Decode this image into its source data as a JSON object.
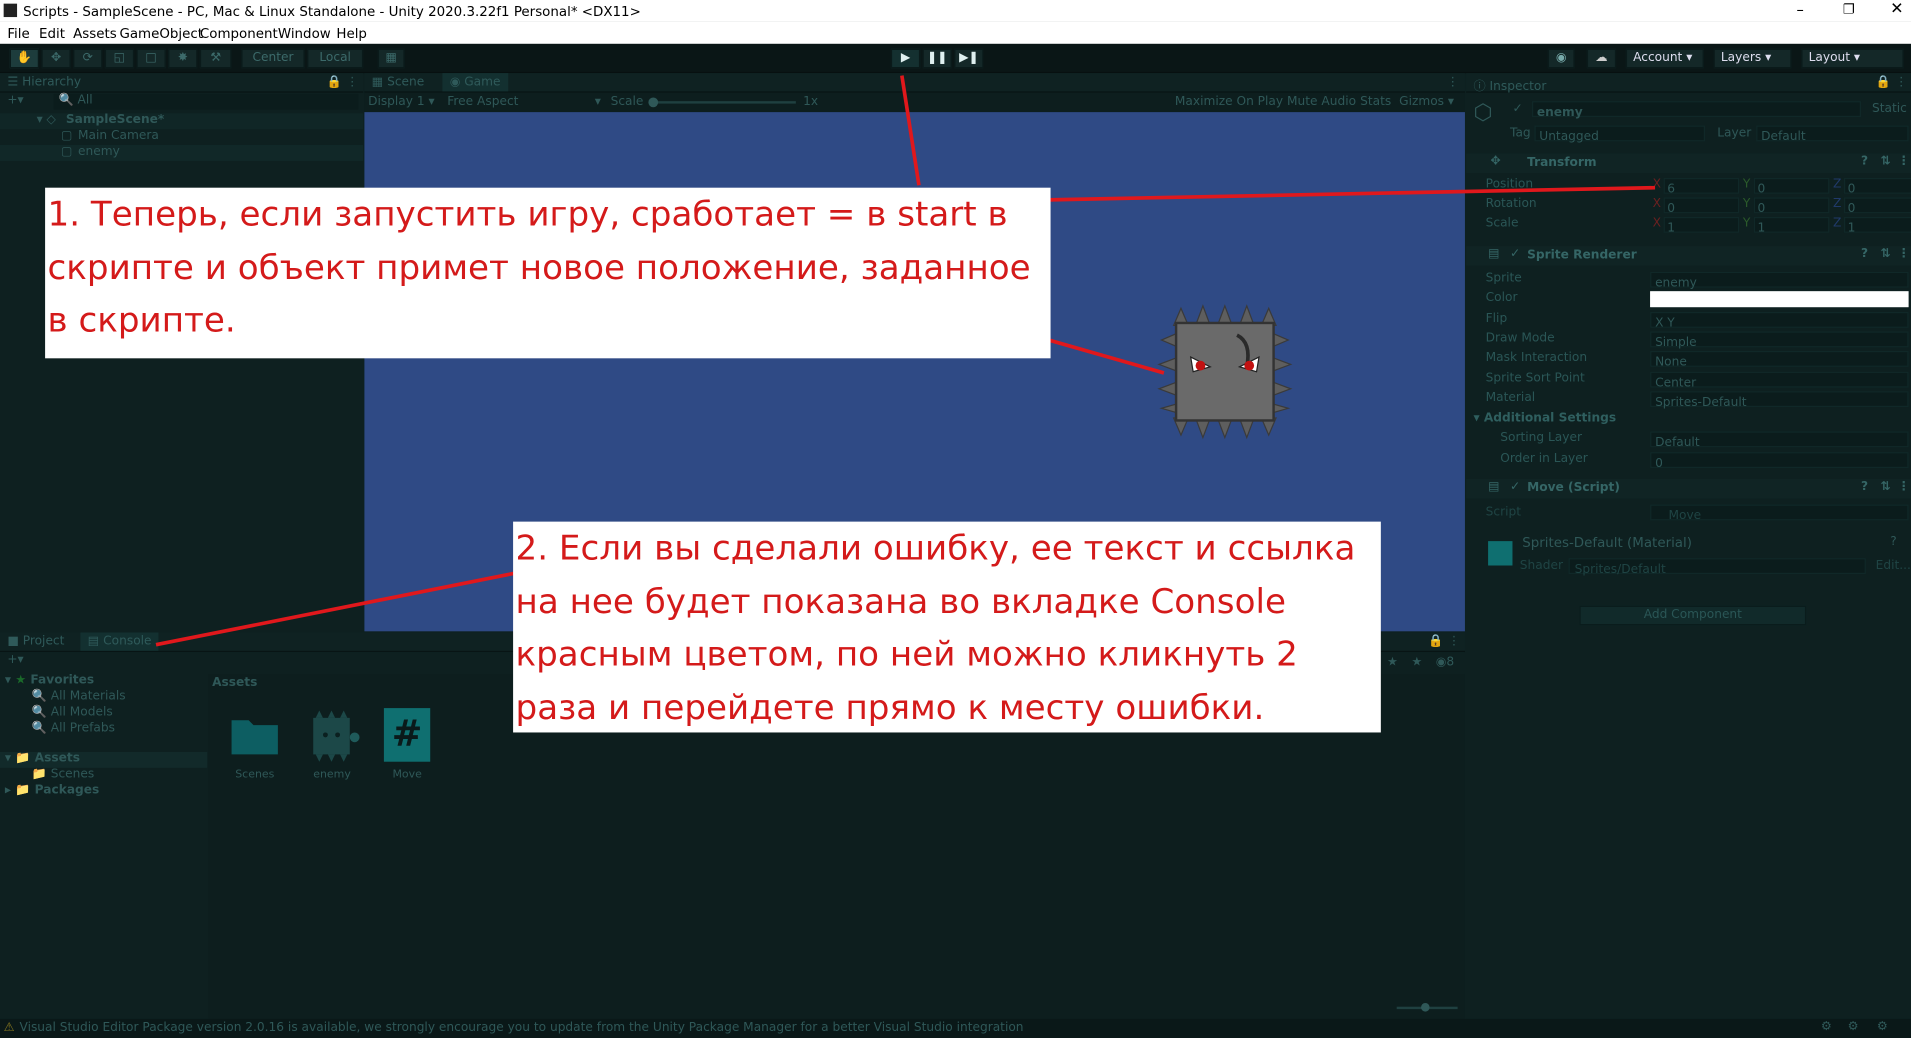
{
  "window": {
    "title": "Scripts - SampleScene - PC, Mac & Linux Standalone - Unity 2020.3.22f1 Personal* <DX11>"
  },
  "menu": [
    "File",
    "Edit",
    "Assets",
    "GameObject",
    "Component",
    "Window",
    "Help"
  ],
  "toolbar": {
    "pivot": "Center",
    "space": "Local",
    "account": "Account",
    "layers": "Layers",
    "layout": "Layout"
  },
  "hierarchy": {
    "tab": "Hierarchy",
    "search": "All",
    "scene": "SampleScene*",
    "items": [
      "Main Camera",
      "enemy"
    ]
  },
  "scene_tabs": {
    "scene": "Scene",
    "game": "Game"
  },
  "game_bar": {
    "display": "Display 1",
    "aspect": "Free Aspect",
    "scale_label": "Scale",
    "scale_value": "1x",
    "maximize": "Maximize On Play",
    "mute": "Mute Audio",
    "stats": "Stats",
    "gizmos": "Gizmos"
  },
  "inspector": {
    "tab": "Inspector",
    "object_name": "enemy",
    "static": "Static",
    "tag_label": "Tag",
    "tag": "Untagged",
    "layer_label": "Layer",
    "layer": "Default",
    "transform": {
      "title": "Transform",
      "rows": [
        {
          "label": "Position",
          "x": "6",
          "y": "0",
          "z": "0"
        },
        {
          "label": "Rotation",
          "x": "0",
          "y": "0",
          "z": "0"
        },
        {
          "label": "Scale",
          "x": "1",
          "y": "1",
          "z": "1"
        }
      ]
    },
    "sprite_renderer": {
      "title": "Sprite Renderer",
      "rows": [
        {
          "label": "Sprite",
          "value": "enemy"
        },
        {
          "label": "Color",
          "value": ""
        },
        {
          "label": "Flip",
          "value": "X   Y"
        },
        {
          "label": "Draw Mode",
          "value": "Simple"
        },
        {
          "label": "Mask Interaction",
          "value": "None"
        },
        {
          "label": "Sprite Sort Point",
          "value": "Center"
        },
        {
          "label": "Material",
          "value": "Sprites-Default"
        }
      ],
      "additional": "Additional Settings",
      "sub_rows": [
        {
          "label": "Sorting Layer",
          "value": "Default"
        },
        {
          "label": "Order in Layer",
          "value": "0"
        }
      ]
    },
    "move_script": {
      "title": "Move (Script)",
      "script_label": "Script",
      "script_value": "Move"
    },
    "material": {
      "name": "Sprites-Default (Material)",
      "shader_label": "Shader",
      "shader": "Sprites/Default",
      "edit": "Edit..."
    },
    "add_component": "Add Component"
  },
  "bottom": {
    "tabs": [
      "Project",
      "Console"
    ],
    "favorites": "Favorites",
    "fav_items": [
      "All Materials",
      "All Models",
      "All Prefabs"
    ],
    "assets_root": "Assets",
    "asset_folders": [
      "Scenes"
    ],
    "packages": "Packages",
    "breadcrumb": "Assets",
    "asset_tiles": [
      "Scenes",
      "enemy",
      "Move"
    ],
    "count": "8"
  },
  "status": "Visual Studio Editor Package version 2.0.16 is available, we strongly encourage you to update from the Unity Package Manager for a better Visual Studio integration",
  "callouts": {
    "first": [
      "1. Теперь, если запустить игру, сработает = в start в",
      "скрипте и объект примет новое положение, заданное",
      "в скрипте."
    ],
    "second": [
      "2. Если вы сделали ошибку, ее текст и ссылка",
      "на нее будет показана во вкладке Console",
      "красным цветом, по ней можно кликнуть 2",
      "раза и перейдете прямо к месту ошибки."
    ]
  },
  "colors": {
    "callout_text": "#d41a1a",
    "game_bg": "#2f4a85",
    "editor_bg": "#0e2020",
    "annotation_line": "#e0181c"
  }
}
